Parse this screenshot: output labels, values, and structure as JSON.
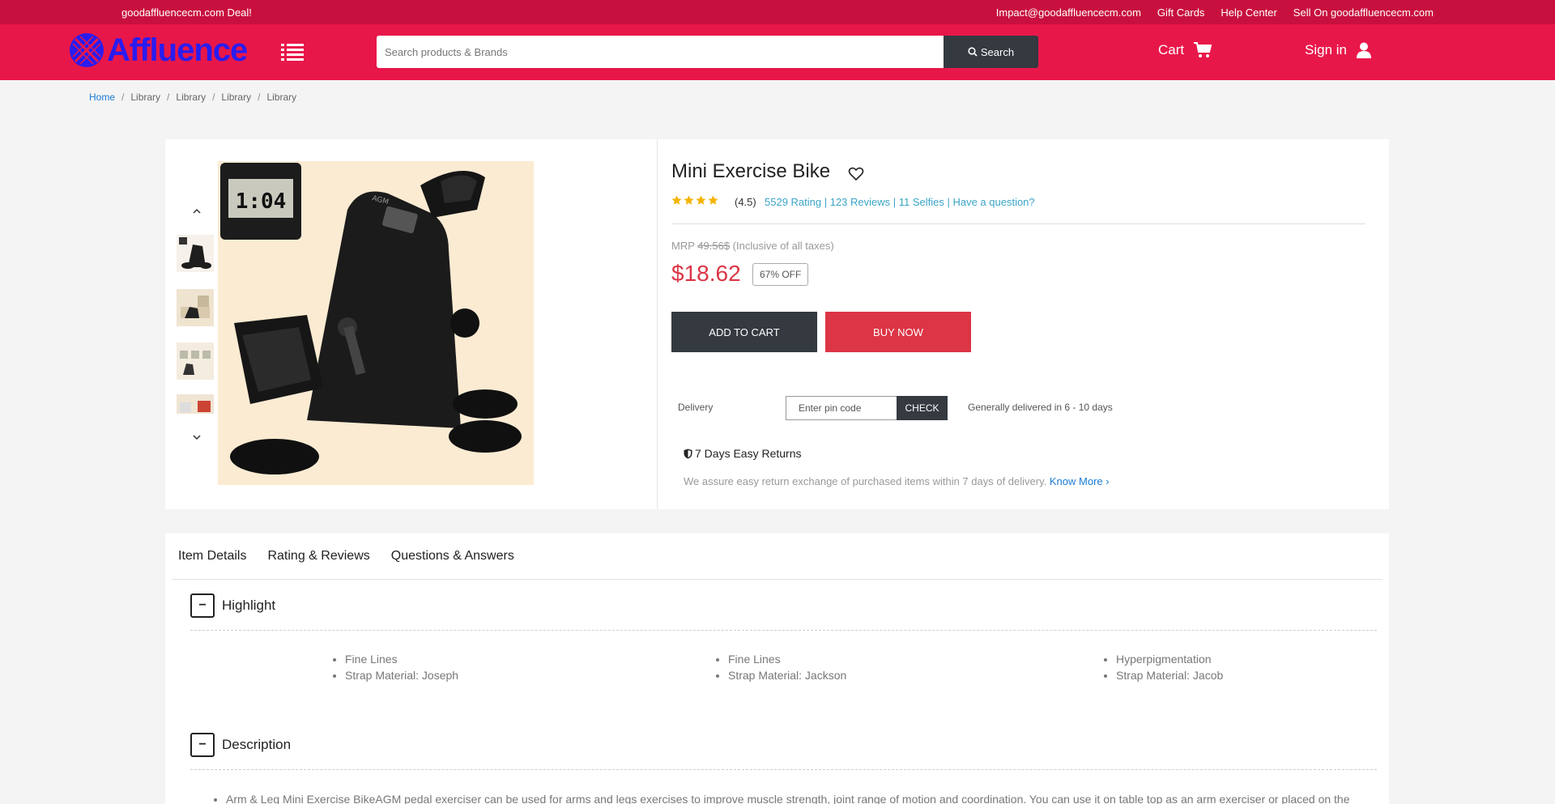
{
  "topbar": {
    "deal": "goodaffluencecm.com Deal!",
    "links": [
      "Impact@goodaffluencecm.com",
      "Gift Cards",
      "Help Center",
      "Sell On goodaffluencecm.com"
    ]
  },
  "header": {
    "logo_text": "Affluence",
    "search_placeholder": "Search products & Brands",
    "search_button": "Search",
    "cart_label": "Cart",
    "signin_label": "Sign in"
  },
  "breadcrumb": [
    "Home",
    "Library",
    "Library",
    "Library",
    "Library"
  ],
  "product": {
    "title": "Mini Exercise Bike",
    "stars": 4,
    "rating_value": "(4.5)",
    "rating_links": "5529 Rating | 123 Reviews | 11 Selfies | Have a question?",
    "mrp_label": "MRP",
    "mrp_value": "49.56$",
    "mrp_note": "(Inclusive of all taxes)",
    "price": "$18.62",
    "discount": "67% OFF",
    "add_to_cart": "ADD TO CART",
    "buy_now": "BUY NOW",
    "delivery_label": "Delivery",
    "pin_placeholder": "Enter pin code",
    "check_button": "CHECK",
    "delivery_note": "Generally delivered in 6 - 10 days",
    "returns_title": "7 Days Easy Returns",
    "returns_text": "We assure easy return exchange of purchased items within 7 days of delivery.",
    "know_more": "Know More",
    "image_display_text": "1:04",
    "image_brand_text": "AGM"
  },
  "details": {
    "tabs": [
      "Item Details",
      "Rating & Reviews",
      "Questions & Answers"
    ],
    "highlight_title": "Highlight",
    "highlights": [
      [
        "Fine Lines",
        "Strap Material: Joseph"
      ],
      [
        "Fine Lines",
        "Strap Material: Jackson"
      ],
      [
        "Hyperpigmentation",
        "Strap Material: Jacob"
      ]
    ],
    "description_title": "Description",
    "description_text": "Arm & Leg Mini Exercise BikeAGM pedal exerciser can be used for arms and legs exercises to improve muscle strength, joint range of motion and coordination. You can use it on table top as an arm exerciser or placed on the"
  },
  "colors": {
    "top_strip": "#c8103e",
    "header": "#e8174a",
    "dark_button": "#343a40",
    "buy_now": "#dc3545",
    "price": "#dc3545",
    "link": "#3aa4c6",
    "star": "#f5b301"
  }
}
